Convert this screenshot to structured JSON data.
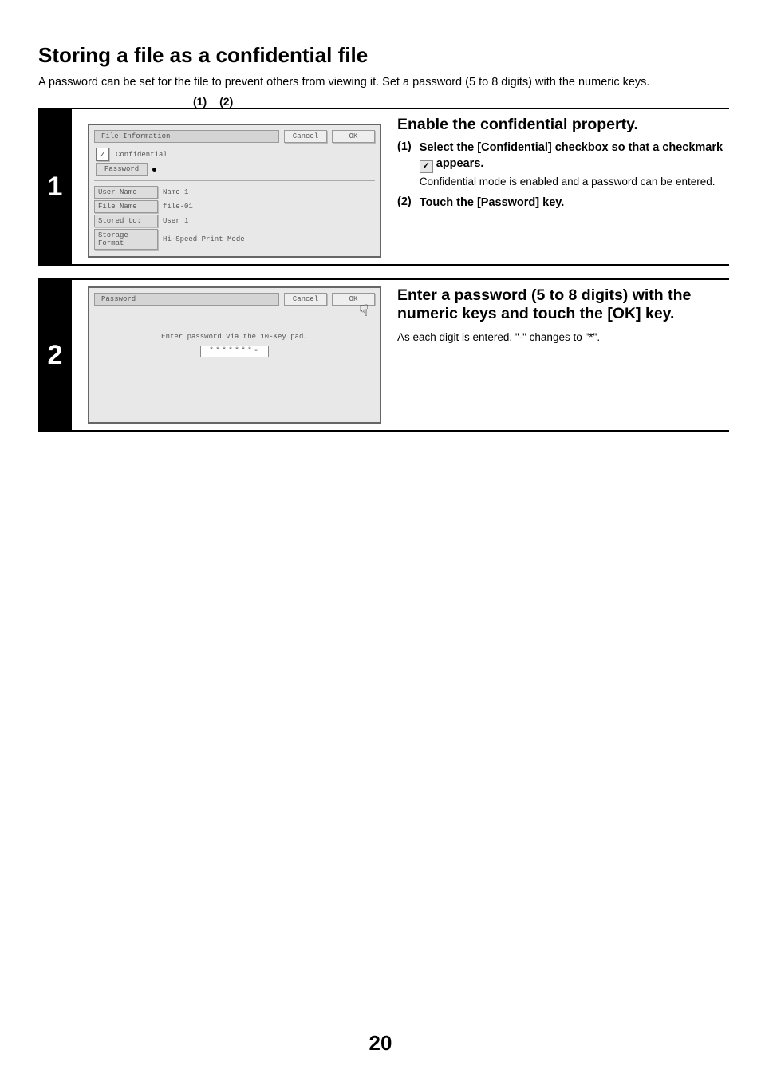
{
  "page_number": "20",
  "heading": "Storing a file as a confidential file",
  "intro": "A password can be set for the file to prevent others from viewing it. Set a password (5 to 8 digits) with the numeric keys.",
  "step1": {
    "num": "1",
    "callout1": "(1)",
    "callout2": "(2)",
    "panel": {
      "title": "File Information",
      "cancel": "Cancel",
      "ok": "OK",
      "confidential_label": "Confidential",
      "checkmark": "✓",
      "password_btn": "Password",
      "rows": {
        "user_name_k": "User Name",
        "user_name_v": "Name 1",
        "file_name_k": "File Name",
        "file_name_v": "file-01",
        "stored_to_k": "Stored to:",
        "stored_to_v": "User 1",
        "storage_k": "Storage Format",
        "storage_v": "Hi-Speed Print Mode"
      }
    },
    "instr_heading": "Enable the confidential property.",
    "sub1_num": "(1)",
    "sub1_title_a": "Select the [Confidential] checkbox so that a checkmark ",
    "sub1_title_b": " appears.",
    "sub1_check": "✓",
    "sub1_desc": "Confidential mode is enabled and a password can be entered.",
    "sub2_num": "(2)",
    "sub2_title": "Touch the [Password] key."
  },
  "step2": {
    "num": "2",
    "panel": {
      "title": "Password",
      "cancel": "Cancel",
      "ok": "OK",
      "prompt": "Enter password via the 10-Key pad.",
      "field": "*******-"
    },
    "instr_heading": "Enter a password (5 to 8 digits) with the numeric keys and touch the [OK] key.",
    "instr_desc_a": "As each digit is entered, \"-\" changes to \"",
    "instr_desc_star": "*",
    "instr_desc_b": "\"."
  }
}
